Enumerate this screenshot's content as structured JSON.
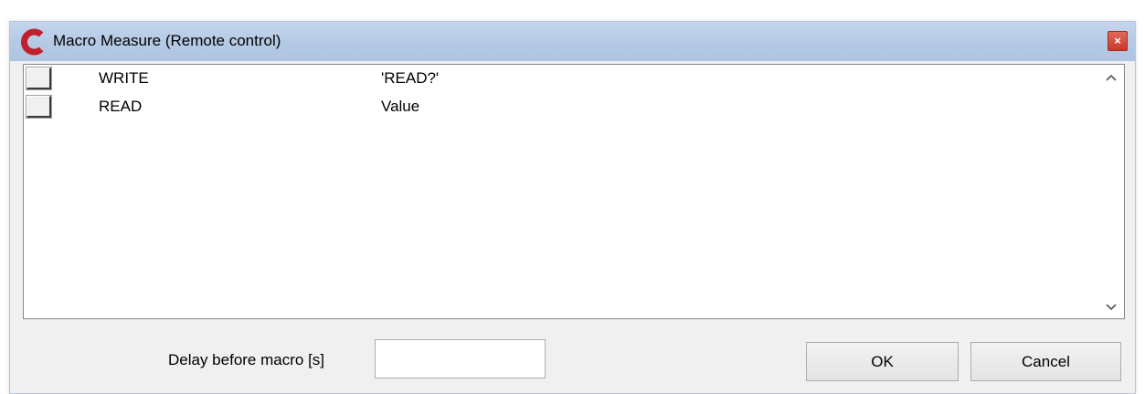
{
  "window": {
    "title": "Macro Measure (Remote control)",
    "close_label": "×",
    "logo_icon": "c-logo-icon",
    "accent_color": "#c0202c"
  },
  "list": {
    "rows": [
      {
        "command": "WRITE",
        "argument": "'READ?'"
      },
      {
        "command": "READ",
        "argument": "Value"
      }
    ],
    "scroll_up_glyph": "^",
    "scroll_down_glyph": "v"
  },
  "footer": {
    "delay_label": "Delay before macro [s]",
    "delay_value": "",
    "ok_label": "OK",
    "cancel_label": "Cancel"
  }
}
